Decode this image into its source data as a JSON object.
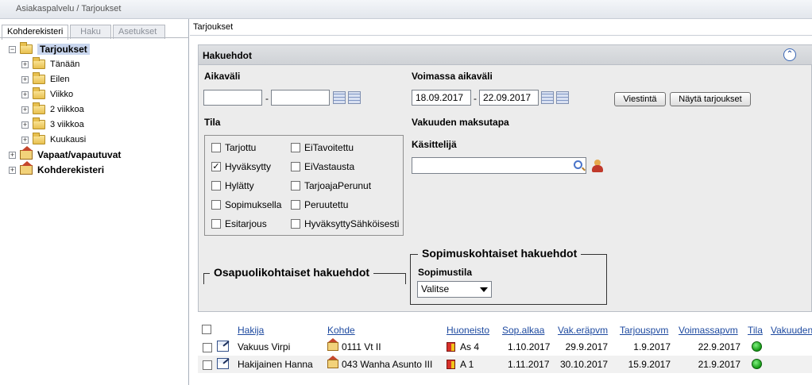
{
  "breadcrumb": "Asiakaspalvelu / Tarjoukset",
  "tabs": [
    "Kohderekisteri",
    "Haku",
    "Asetukset"
  ],
  "tree": {
    "root": "Tarjoukset",
    "children": [
      "Tänään",
      "Eilen",
      "Viikko",
      "2 viikkoa",
      "3 viikkoa",
      "Kuukausi"
    ],
    "others": [
      "Vapaat/vapautuvat",
      "Kohderekisteri"
    ]
  },
  "page_title": "Tarjoukset",
  "search": {
    "heading": "Hakuehdot",
    "aikavali_label": "Aikaväli",
    "aikavali_from": "",
    "aikavali_to": "",
    "voimassa_label": "Voimassa aikaväli",
    "voimassa_from": "18.09.2017",
    "voimassa_to": "22.09.2017",
    "dash": "-",
    "viestinta_button": "Viestintä",
    "nayta_button": "Näytä tarjoukset",
    "tila_label": "Tila",
    "tila_left": [
      {
        "label": "Tarjottu",
        "checked": false
      },
      {
        "label": "Hyväksytty",
        "checked": true
      },
      {
        "label": "Hylätty",
        "checked": false
      },
      {
        "label": "Sopimuksella",
        "checked": false
      },
      {
        "label": "Esitarjous",
        "checked": false
      }
    ],
    "tila_right": [
      {
        "label": "EiTavoitettu",
        "checked": false
      },
      {
        "label": "EiVastausta",
        "checked": false
      },
      {
        "label": "TarjoajaPerunut",
        "checked": false
      },
      {
        "label": "Peruutettu",
        "checked": false
      },
      {
        "label": "HyväksyttySähköisesti",
        "checked": false
      }
    ],
    "maksutapa_label": "Vakuuden maksutapa",
    "kasittelija_label": "Käsittelijä",
    "kasittelija_value": "",
    "osapuoli_legend": "Osapuolikohtaiset hakuehdot",
    "sopimus_legend": "Sopimuskohtaiset hakuehdot",
    "sopimustila_label": "Sopimustila",
    "sopimustila_value": "Valitse",
    "check_mark": "✓",
    "collapse_icon": "⌃"
  },
  "table": {
    "columns": [
      "Hakija",
      "Kohde",
      "Huoneisto",
      "Sop.alkaa",
      "Vak.eräpvm",
      "Tarjouspvm",
      "Voimassapvm",
      "Tila",
      "Vakuuden"
    ],
    "rows": [
      {
        "hakija": "Vakuus Virpi",
        "kohde": "0111 Vt II",
        "huoneisto": "As 4",
        "sop_alkaa": "1.10.2017",
        "vak_erapvm": "29.9.2017",
        "tarjouspvm": "1.9.2017",
        "voimassapvm": "22.9.2017",
        "tila": "green"
      },
      {
        "hakija": "Hakijainen Hanna",
        "kohde": "043 Wanha Asunto III",
        "huoneisto": "A 1",
        "sop_alkaa": "1.11.2017",
        "vak_erapvm": "30.10.2017",
        "tarjouspvm": "15.9.2017",
        "voimassapvm": "21.9.2017",
        "tila": "green"
      }
    ]
  },
  "colors": {
    "link": "#1e4aa0",
    "panel_bg": "#ececec",
    "tree_selected": "#c9d6ee",
    "status_green": "#149a14"
  }
}
